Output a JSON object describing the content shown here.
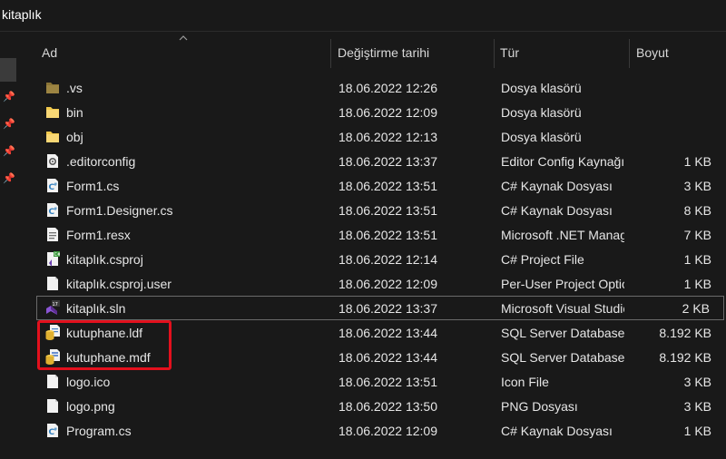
{
  "window": {
    "title": "kitaplık"
  },
  "colors": {
    "annotation": "#e3101d",
    "folder": "#f2c94c",
    "background": "#191919"
  },
  "columns": [
    {
      "key": "name",
      "label": "Ad"
    },
    {
      "key": "date",
      "label": "Değiştirme tarihi"
    },
    {
      "key": "type",
      "label": "Tür"
    },
    {
      "key": "size",
      "label": "Boyut"
    }
  ],
  "sort": {
    "column": "name",
    "direction": "ascending",
    "icon": "sort-up-chevron"
  },
  "files": [
    {
      "name": ".vs",
      "date": "18.06.2022 12:26",
      "type": "Dosya klasörü",
      "size": "",
      "icon": "folder-dark-icon"
    },
    {
      "name": "bin",
      "date": "18.06.2022 12:09",
      "type": "Dosya klasörü",
      "size": "",
      "icon": "folder-icon"
    },
    {
      "name": "obj",
      "date": "18.06.2022 12:13",
      "type": "Dosya klasörü",
      "size": "",
      "icon": "folder-icon"
    },
    {
      "name": ".editorconfig",
      "date": "18.06.2022 13:37",
      "type": "Editor Config Kaynağı",
      "size": "1 KB",
      "icon": "gear-file-icon"
    },
    {
      "name": "Form1.cs",
      "date": "18.06.2022 13:51",
      "type": "C# Kaynak Dosyası",
      "size": "3 KB",
      "icon": "csharp-file-icon"
    },
    {
      "name": "Form1.Designer.cs",
      "date": "18.06.2022 13:51",
      "type": "C# Kaynak Dosyası",
      "size": "8 KB",
      "icon": "csharp-file-icon"
    },
    {
      "name": "Form1.resx",
      "date": "18.06.2022 13:51",
      "type": "Microsoft .NET Managed Resources File",
      "size": "7 KB",
      "icon": "resx-file-icon"
    },
    {
      "name": "kitaplık.csproj",
      "date": "18.06.2022 12:14",
      "type": "C# Project File",
      "size": "1 KB",
      "icon": "csproj-file-icon"
    },
    {
      "name": "kitaplık.csproj.user",
      "date": "18.06.2022 12:09",
      "type": "Per-User Project Options File",
      "size": "1 KB",
      "icon": "blank-file-icon"
    },
    {
      "name": "kitaplık.sln",
      "date": "18.06.2022 13:37",
      "type": "Microsoft Visual Studio Solution",
      "size": "2 KB",
      "icon": "visual-studio-solution-icon",
      "selected": true
    },
    {
      "name": "kutuphane.ldf",
      "date": "18.06.2022 13:44",
      "type": "SQL Server Database Transaction Log File",
      "size": "8.192 KB",
      "icon": "database-log-file-icon"
    },
    {
      "name": "kutuphane.mdf",
      "date": "18.06.2022 13:44",
      "type": "SQL Server Database Primary Data File",
      "size": "8.192 KB",
      "icon": "database-file-icon"
    },
    {
      "name": "logo.ico",
      "date": "18.06.2022 13:51",
      "type": "Icon File",
      "size": "3 KB",
      "icon": "blank-file-icon"
    },
    {
      "name": "logo.png",
      "date": "18.06.2022 13:50",
      "type": "PNG Dosyası",
      "size": "3 KB",
      "icon": "blank-file-icon"
    },
    {
      "name": "Program.cs",
      "date": "18.06.2022 12:09",
      "type": "C# Kaynak Dosyası",
      "size": "1 KB",
      "icon": "csharp-file-icon"
    }
  ],
  "quick_access_pins": [
    "pin-icon",
    "pin-icon",
    "pin-icon",
    "pin-icon"
  ]
}
